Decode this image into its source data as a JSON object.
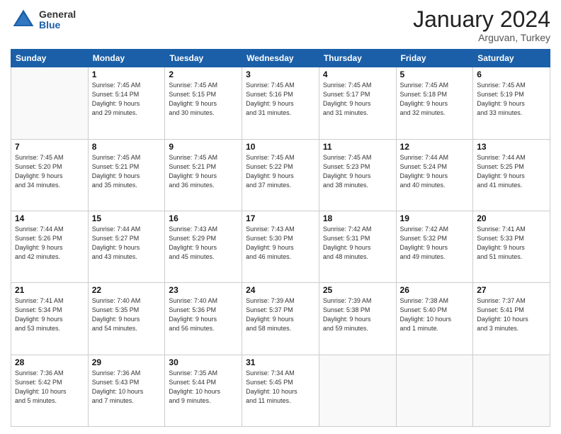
{
  "logo": {
    "general": "General",
    "blue": "Blue"
  },
  "title": "January 2024",
  "location": "Arguvan, Turkey",
  "days_header": [
    "Sunday",
    "Monday",
    "Tuesday",
    "Wednesday",
    "Thursday",
    "Friday",
    "Saturday"
  ],
  "weeks": [
    [
      {
        "day": "",
        "info": ""
      },
      {
        "day": "1",
        "info": "Sunrise: 7:45 AM\nSunset: 5:14 PM\nDaylight: 9 hours\nand 29 minutes."
      },
      {
        "day": "2",
        "info": "Sunrise: 7:45 AM\nSunset: 5:15 PM\nDaylight: 9 hours\nand 30 minutes."
      },
      {
        "day": "3",
        "info": "Sunrise: 7:45 AM\nSunset: 5:16 PM\nDaylight: 9 hours\nand 31 minutes."
      },
      {
        "day": "4",
        "info": "Sunrise: 7:45 AM\nSunset: 5:17 PM\nDaylight: 9 hours\nand 31 minutes."
      },
      {
        "day": "5",
        "info": "Sunrise: 7:45 AM\nSunset: 5:18 PM\nDaylight: 9 hours\nand 32 minutes."
      },
      {
        "day": "6",
        "info": "Sunrise: 7:45 AM\nSunset: 5:19 PM\nDaylight: 9 hours\nand 33 minutes."
      }
    ],
    [
      {
        "day": "7",
        "info": "Sunrise: 7:45 AM\nSunset: 5:20 PM\nDaylight: 9 hours\nand 34 minutes."
      },
      {
        "day": "8",
        "info": "Sunrise: 7:45 AM\nSunset: 5:21 PM\nDaylight: 9 hours\nand 35 minutes."
      },
      {
        "day": "9",
        "info": "Sunrise: 7:45 AM\nSunset: 5:21 PM\nDaylight: 9 hours\nand 36 minutes."
      },
      {
        "day": "10",
        "info": "Sunrise: 7:45 AM\nSunset: 5:22 PM\nDaylight: 9 hours\nand 37 minutes."
      },
      {
        "day": "11",
        "info": "Sunrise: 7:45 AM\nSunset: 5:23 PM\nDaylight: 9 hours\nand 38 minutes."
      },
      {
        "day": "12",
        "info": "Sunrise: 7:44 AM\nSunset: 5:24 PM\nDaylight: 9 hours\nand 40 minutes."
      },
      {
        "day": "13",
        "info": "Sunrise: 7:44 AM\nSunset: 5:25 PM\nDaylight: 9 hours\nand 41 minutes."
      }
    ],
    [
      {
        "day": "14",
        "info": "Sunrise: 7:44 AM\nSunset: 5:26 PM\nDaylight: 9 hours\nand 42 minutes."
      },
      {
        "day": "15",
        "info": "Sunrise: 7:44 AM\nSunset: 5:27 PM\nDaylight: 9 hours\nand 43 minutes."
      },
      {
        "day": "16",
        "info": "Sunrise: 7:43 AM\nSunset: 5:29 PM\nDaylight: 9 hours\nand 45 minutes."
      },
      {
        "day": "17",
        "info": "Sunrise: 7:43 AM\nSunset: 5:30 PM\nDaylight: 9 hours\nand 46 minutes."
      },
      {
        "day": "18",
        "info": "Sunrise: 7:42 AM\nSunset: 5:31 PM\nDaylight: 9 hours\nand 48 minutes."
      },
      {
        "day": "19",
        "info": "Sunrise: 7:42 AM\nSunset: 5:32 PM\nDaylight: 9 hours\nand 49 minutes."
      },
      {
        "day": "20",
        "info": "Sunrise: 7:41 AM\nSunset: 5:33 PM\nDaylight: 9 hours\nand 51 minutes."
      }
    ],
    [
      {
        "day": "21",
        "info": "Sunrise: 7:41 AM\nSunset: 5:34 PM\nDaylight: 9 hours\nand 53 minutes."
      },
      {
        "day": "22",
        "info": "Sunrise: 7:40 AM\nSunset: 5:35 PM\nDaylight: 9 hours\nand 54 minutes."
      },
      {
        "day": "23",
        "info": "Sunrise: 7:40 AM\nSunset: 5:36 PM\nDaylight: 9 hours\nand 56 minutes."
      },
      {
        "day": "24",
        "info": "Sunrise: 7:39 AM\nSunset: 5:37 PM\nDaylight: 9 hours\nand 58 minutes."
      },
      {
        "day": "25",
        "info": "Sunrise: 7:39 AM\nSunset: 5:38 PM\nDaylight: 9 hours\nand 59 minutes."
      },
      {
        "day": "26",
        "info": "Sunrise: 7:38 AM\nSunset: 5:40 PM\nDaylight: 10 hours\nand 1 minute."
      },
      {
        "day": "27",
        "info": "Sunrise: 7:37 AM\nSunset: 5:41 PM\nDaylight: 10 hours\nand 3 minutes."
      }
    ],
    [
      {
        "day": "28",
        "info": "Sunrise: 7:36 AM\nSunset: 5:42 PM\nDaylight: 10 hours\nand 5 minutes."
      },
      {
        "day": "29",
        "info": "Sunrise: 7:36 AM\nSunset: 5:43 PM\nDaylight: 10 hours\nand 7 minutes."
      },
      {
        "day": "30",
        "info": "Sunrise: 7:35 AM\nSunset: 5:44 PM\nDaylight: 10 hours\nand 9 minutes."
      },
      {
        "day": "31",
        "info": "Sunrise: 7:34 AM\nSunset: 5:45 PM\nDaylight: 10 hours\nand 11 minutes."
      },
      {
        "day": "",
        "info": ""
      },
      {
        "day": "",
        "info": ""
      },
      {
        "day": "",
        "info": ""
      }
    ]
  ]
}
